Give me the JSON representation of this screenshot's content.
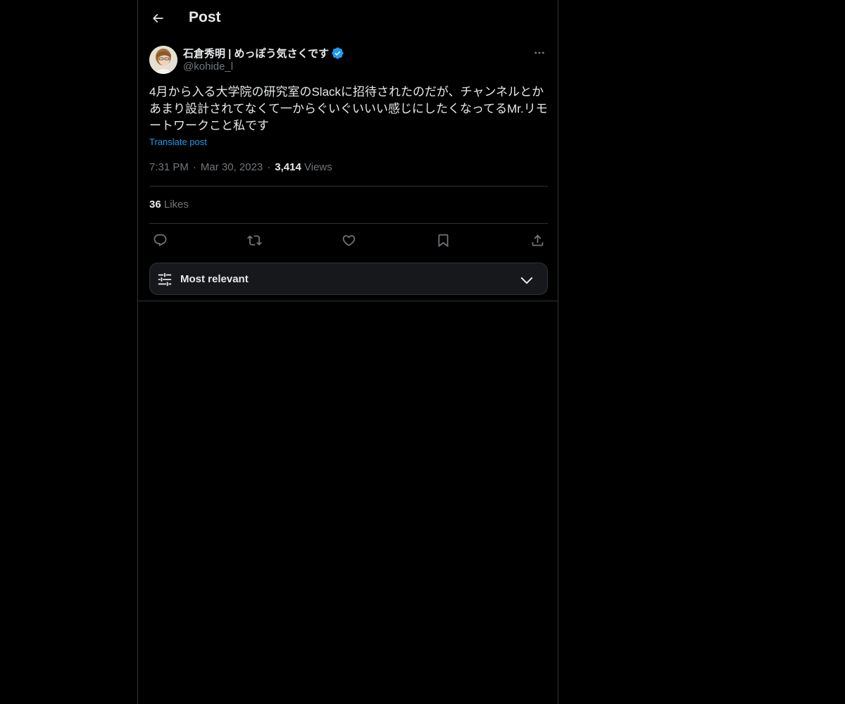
{
  "header": {
    "title": "Post",
    "back_icon": "arrow-left-icon"
  },
  "author": {
    "display_name": "石倉秀明 | めっぽう気さくです",
    "handle": "@kohide_l",
    "verified_icon": "verified-badge-icon",
    "more_icon": "more-horizontal-icon"
  },
  "post": {
    "text": "4月から入る大学院の研究室のSlackに招待されたのだが、チャンネルとかあまり設計されてなくて一からぐいぐいいい感じにしたくなってるMr.リモートワークこと私です",
    "translate_label": "Translate post",
    "time": "7:31 PM",
    "date": "Mar 30, 2023",
    "separator": "·",
    "views_count": "3,414",
    "views_label": "Views",
    "likes_count": "36",
    "likes_label": "Likes"
  },
  "actions": [
    {
      "name": "reply",
      "icon": "reply-icon"
    },
    {
      "name": "repost",
      "icon": "repost-icon"
    },
    {
      "name": "like",
      "icon": "heart-icon"
    },
    {
      "name": "bookmark",
      "icon": "bookmark-icon"
    },
    {
      "name": "share",
      "icon": "share-icon"
    }
  ],
  "sort": {
    "label": "Most relevant",
    "icon": "sliders-icon",
    "chevron_icon": "chevron-down-icon"
  },
  "colors": {
    "background": "#000000",
    "text_primary": "#e7e9ea",
    "text_secondary": "#71767b",
    "accent": "#1d9bf0",
    "border": "#2f3336"
  }
}
